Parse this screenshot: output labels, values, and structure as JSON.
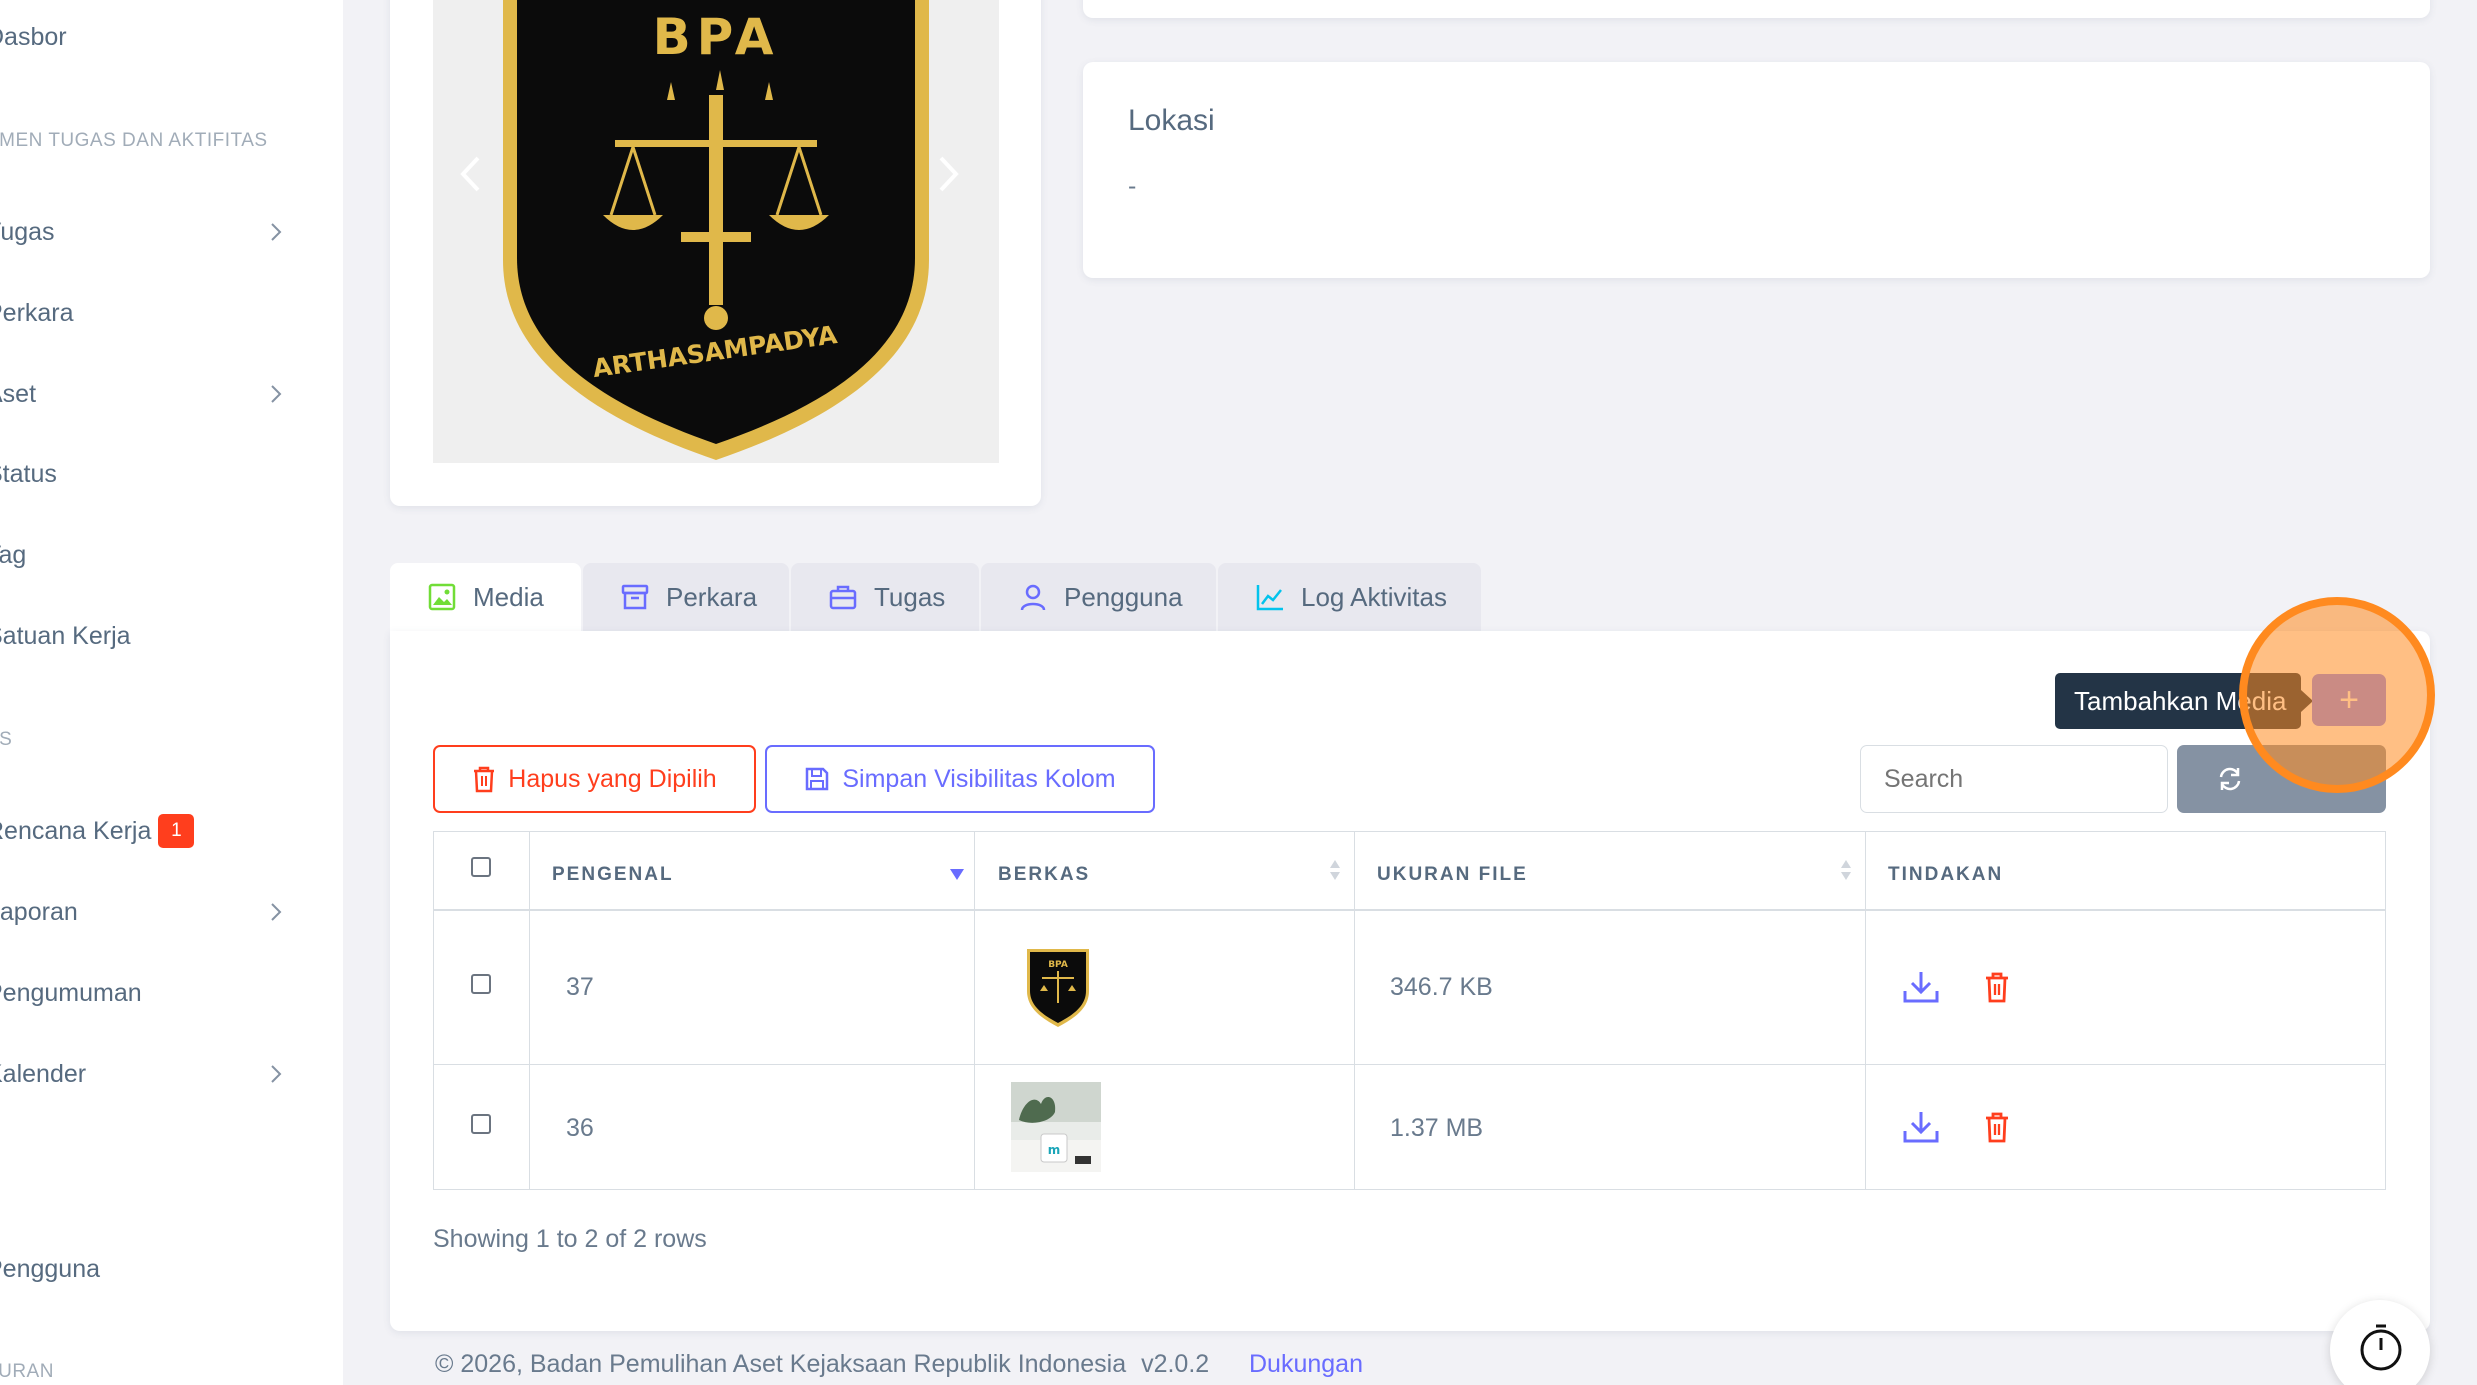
{
  "sidebar": {
    "items": [
      {
        "label": "Dasbor"
      },
      {
        "label": "Tugas"
      },
      {
        "label": "Perkara"
      },
      {
        "label": "Aset"
      },
      {
        "label": "Status"
      },
      {
        "label": "Tag"
      },
      {
        "label": "Satuan Kerja"
      },
      {
        "label": "Rencana Kerja",
        "badge": "1"
      },
      {
        "label": "Laporan"
      },
      {
        "label": "Pengumuman"
      },
      {
        "label": "Kalender"
      },
      {
        "label": "Pengguna"
      }
    ],
    "headers": [
      "EMEN TUGAS DAN AKTIFITAS",
      "AS",
      "TURAN"
    ]
  },
  "logo": {
    "top_text": "BPA",
    "bottom_text": "ARTHASAMPADYA"
  },
  "location": {
    "title": "Lokasi",
    "value": "-"
  },
  "tabs": [
    {
      "label": "Media",
      "icon": "image-icon"
    },
    {
      "label": "Perkara",
      "icon": "archive-icon"
    },
    {
      "label": "Tugas",
      "icon": "briefcase-icon"
    },
    {
      "label": "Pengguna",
      "icon": "user-icon"
    },
    {
      "label": "Log Aktivitas",
      "icon": "chart-line-icon"
    }
  ],
  "toolbar": {
    "tooltip": "Tambahkan Media",
    "add_symbol": "+",
    "delete_selected": "Hapus yang Dipilih",
    "save_visibility": "Simpan Visibilitas Kolom",
    "search_placeholder": "Search"
  },
  "table": {
    "headers": [
      "PENGENAL",
      "BERKAS",
      "UKURAN FILE",
      "TINDAKAN"
    ],
    "rows": [
      {
        "id": "37",
        "file": "BPA logo",
        "size": "346.7 KB"
      },
      {
        "id": "36",
        "file": "mug photo",
        "size": "1.37 MB"
      }
    ],
    "pagination": "Showing 1 to 2 of 2 rows"
  },
  "footer": {
    "copyright": "© 2026, Badan Pemulihan Aset Kejaksaan Republik Indonesia",
    "version": "v2.0.2",
    "support": "Dukungan"
  },
  "colors": {
    "primary": "#696cff",
    "danger": "#ff3e1d",
    "gold": "#e0b84a",
    "highlight": "#ff8a1f",
    "tooltip_bg": "#233446"
  }
}
